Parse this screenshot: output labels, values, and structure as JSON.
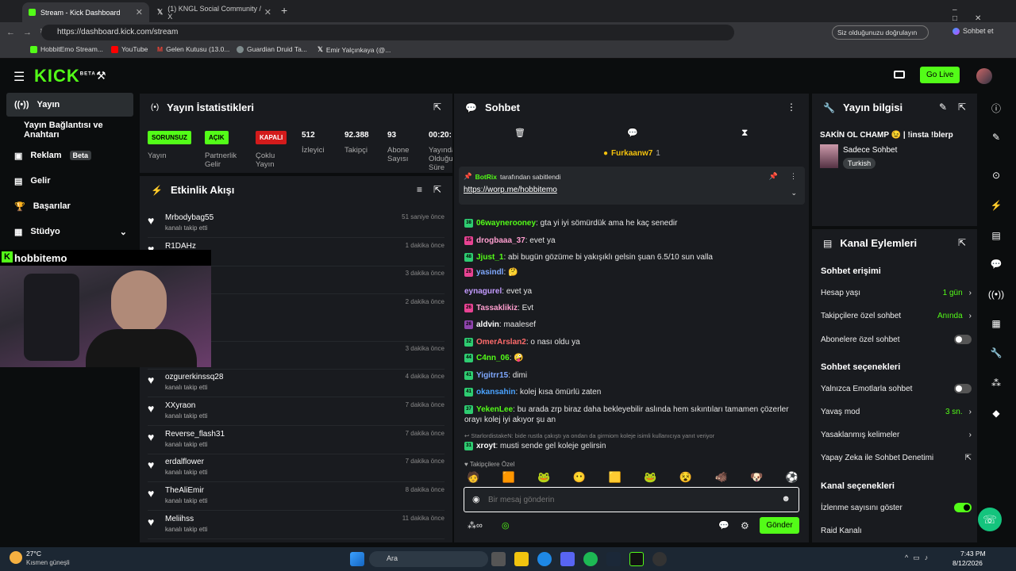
{
  "browser": {
    "tabs": [
      {
        "title": "Stream - Kick Dashboard",
        "active": true
      },
      {
        "title": "(1) KNGL Social Community / X",
        "active": false
      }
    ],
    "url": "https://dashboard.kick.com/stream",
    "verify_pill": "Siz olduğunuzu doğrulayın",
    "copilot": "Sohbet et",
    "bookmarks": [
      "HobbitEmo Stream...",
      "YouTube",
      "Gelen Kutusu (13.0...",
      "Guardian Druid Ta...",
      "Emir Yalçınkaya (@..."
    ]
  },
  "header": {
    "logo": "KICK",
    "logo_badge": "BETA",
    "go_live": "Go Live"
  },
  "sidebar": {
    "items": [
      {
        "label": "Yayın",
        "active": true
      },
      {
        "label": "Yayın Bağlantısı ve Anahtarı"
      },
      {
        "label": "Reklam",
        "badge": "Beta"
      },
      {
        "label": "Gelir"
      },
      {
        "label": "Başarılar"
      },
      {
        "label": "Stüdyo"
      }
    ]
  },
  "stats": {
    "title": "Yayın İstatistikleri",
    "items": [
      {
        "badge": "SORUNSUZ",
        "label": "Yayın"
      },
      {
        "badge": "AÇIK",
        "label": "Partnerlik Gelir"
      },
      {
        "badge": "KAPALI",
        "label": "Çoklu Yayın"
      },
      {
        "value": "512",
        "label": "İzleyici"
      },
      {
        "value": "92.388",
        "label": "Takipçi"
      },
      {
        "value": "93",
        "label": "Abone Sayısı"
      },
      {
        "value": "00:20:",
        "label": "Yayında Olduğu Süre"
      }
    ]
  },
  "activity": {
    "title": "Etkinlik Akışı",
    "overlay_name": "hobbitemo",
    "events": [
      {
        "name": "Mrbodybag55",
        "sub": "kanalı takip etti",
        "time": "51 saniye önce"
      },
      {
        "name": "R1DAHz",
        "sub": "",
        "time": "1 dakika önce"
      },
      {
        "name": "",
        "sub": "",
        "time": "3 dakika önce"
      },
      {
        "name": "",
        "sub": "",
        "time": "2 dakika önce"
      },
      {
        "name": "",
        "sub": "",
        "time": "3 dakika önce"
      },
      {
        "name": "ozgurerkinssq28",
        "sub": "kanalı takip etti",
        "time": "4 dakika önce"
      },
      {
        "name": "XXyraon",
        "sub": "kanalı takip etti",
        "time": "7 dakika önce"
      },
      {
        "name": "Reverse_flash31",
        "sub": "kanalı takip etti",
        "time": "7 dakika önce"
      },
      {
        "name": "erdalflower",
        "sub": "kanalı takip etti",
        "time": "7 dakika önce"
      },
      {
        "name": "TheAliEmir",
        "sub": "kanalı takip etti",
        "time": "8 dakika önce"
      },
      {
        "name": "Meliihss",
        "sub": "kanalı takip etti",
        "time": "11 dakika önce"
      }
    ]
  },
  "chat": {
    "title": "Sohbet",
    "top_user": "Furkaanw7",
    "top_count": "1",
    "pinned_by": "BotRix",
    "pinned_suffix": "tarafından sabitlendi",
    "pinned_link": "https://worp.me/hobbitemo",
    "messages": [
      {
        "user": "06waynerooney",
        "color": "#53fc18",
        "badge": "38",
        "badge_color": "#2ecc71",
        "text": "gta yi iyi sömürdük ama he kaç senedir"
      },
      {
        "user": "drogbaaa_37",
        "color": "#ff9ecf",
        "badge": "35",
        "badge_color": "#e84393",
        "text": "evet ya"
      },
      {
        "user": "Jjust_1",
        "color": "#53fc18",
        "badge": "48",
        "badge_color": "#2ecc71",
        "text": "abi bugün gözüme bi yakışıklı gelsin şuan 6.5/10 sun valla"
      },
      {
        "user": "yasindl",
        "color": "#7fa8ff",
        "badge": "26",
        "badge_color": "#e84393",
        "text": "🤔"
      },
      {
        "user": "eynagurel",
        "color": "#c39bff",
        "badge": "",
        "badge_color": "",
        "text": "evet ya"
      },
      {
        "user": "Tassaklikiz",
        "color": "#ff9ecf",
        "badge": "26",
        "badge_color": "#e84393",
        "text": "Evt"
      },
      {
        "user": "aldvin",
        "color": "#ffffff",
        "badge": "26",
        "badge_color": "#8e44ad",
        "text": "maalesef"
      },
      {
        "user": "OmerArslan2",
        "color": "#ff6b6b",
        "badge": "32",
        "badge_color": "#2ecc71",
        "text": "o nası oldu ya"
      },
      {
        "user": "C4nn_06",
        "color": "#53fc18",
        "badge": "44",
        "badge_color": "#2ecc71",
        "text": "🤪"
      },
      {
        "user": "Yigitrr15",
        "color": "#7fa8ff",
        "badge": "41",
        "badge_color": "#2ecc71",
        "text": "dimi"
      },
      {
        "user": "okansahin",
        "color": "#4aa3ff",
        "badge": "41",
        "badge_color": "#2ecc71",
        "text": "kolej kısa ömürlü zaten"
      },
      {
        "user": "YekenLee",
        "color": "#53fc18",
        "badge": "37",
        "badge_color": "#2ecc71",
        "text": "bu arada zrp biraz daha bekleyebilir aslında hem sıkıntıları tamamen çözerler orayı kolej iyi akıyor şu an"
      },
      {
        "user": "xroyt",
        "color": "#ffffff",
        "badge": "31",
        "badge_color": "#2ecc71",
        "text": "musti sende gel koleje gelirsin"
      }
    ],
    "reply_hint": "StarlordistakeN: bide rustla çakıştı ya ondan da girmiom koleje isimli kullanıcıya yanıt veriyor",
    "followers_only": "Takipçilere Özel",
    "input_placeholder": "Bir mesaj gönderin",
    "send": "Gönder"
  },
  "stream_info": {
    "title": "Yayın bilgisi",
    "stream_title": "SAKİN OL CHAMP 😉 | !insta !blerp",
    "category": "Sadece Sohbet",
    "tag": "Turkish"
  },
  "channel": {
    "title": "Kanal Eylemleri",
    "chat_access_heading": "Sohbet erişimi",
    "account_age": {
      "label": "Hesap yaşı",
      "value": "1 gün"
    },
    "followers_only": {
      "label": "Takipçilere özel sohbet",
      "value": "Anında"
    },
    "subscribers_only": {
      "label": "Abonelere özel sohbet",
      "on": false
    },
    "chat_options_heading": "Sohbet seçenekleri",
    "emote_only": {
      "label": "Yalnızca Emotlarla sohbet",
      "on": false
    },
    "slow_mode": {
      "label": "Yavaş mod",
      "value": "3 sn."
    },
    "banned_words": {
      "label": "Yasaklanmış kelimeler"
    },
    "ai_moderation": {
      "label": "Yapay Zeka ile Sohbet Denetimi"
    },
    "channel_options_heading": "Kanal seçenekleri",
    "show_viewers": {
      "label": "İzlenme sayısını göster",
      "on": true
    },
    "raid": {
      "label": "Raid Kanalı"
    }
  },
  "taskbar": {
    "temp": "27°C",
    "weather": "Kısmen güneşli",
    "search": "Ara",
    "time": "7:43 PM",
    "date": "8/12/2026"
  }
}
